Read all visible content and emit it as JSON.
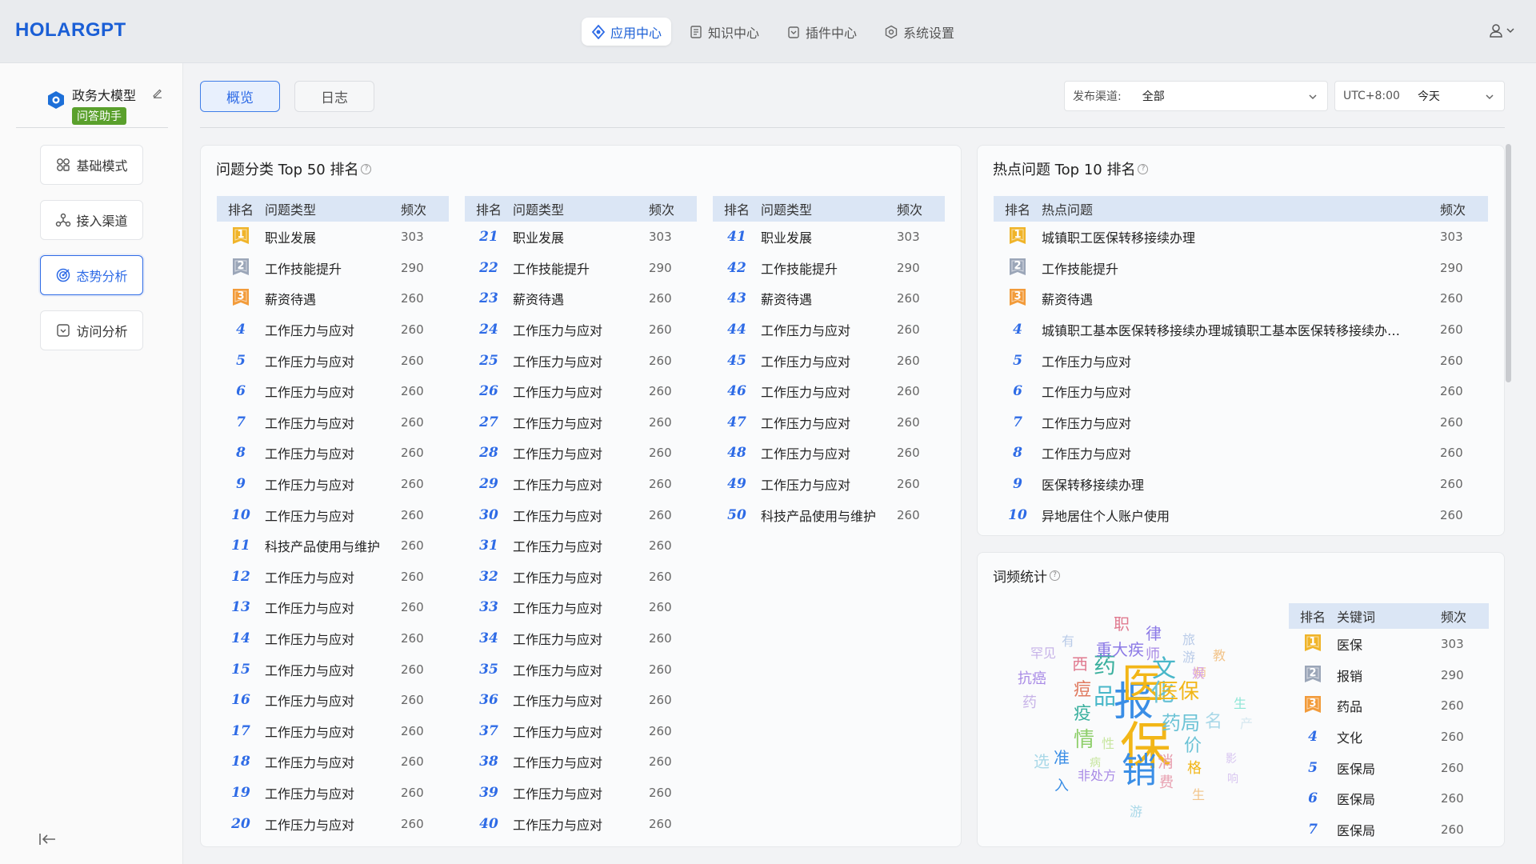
{
  "brand": {
    "logo": "HOLARGPT"
  },
  "nav": {
    "items": [
      {
        "label": "应用中心",
        "icon": "app-center-icon",
        "active": true
      },
      {
        "label": "知识中心",
        "icon": "knowledge-icon",
        "active": false
      },
      {
        "label": "插件中心",
        "icon": "plugin-icon",
        "active": false
      },
      {
        "label": "系统设置",
        "icon": "settings-icon",
        "active": false
      }
    ]
  },
  "sidebar": {
    "app_name": "政务大模型",
    "app_badge": "问答助手",
    "items": [
      {
        "label": "基础模式",
        "icon": "basic-mode-icon",
        "active": false
      },
      {
        "label": "接入渠道",
        "icon": "channel-icon",
        "active": false
      },
      {
        "label": "态势分析",
        "icon": "analysis-icon",
        "active": true
      },
      {
        "label": "访问分析",
        "icon": "visit-icon",
        "active": false
      }
    ]
  },
  "tabs": [
    {
      "label": "概览",
      "active": true
    },
    {
      "label": "日志",
      "active": false
    }
  ],
  "filters": {
    "channel_label": "发布渠道:",
    "channel_value": "全部",
    "tz_label": "UTC+8:00",
    "date_value": "今天"
  },
  "top50": {
    "title": "问题分类 Top 50 排名",
    "headers": {
      "rank": "排名",
      "type": "问题类型",
      "freq": "频次"
    },
    "col1": [
      {
        "rank": "1",
        "type": "职业发展",
        "freq": "303"
      },
      {
        "rank": "2",
        "type": "工作技能提升",
        "freq": "290"
      },
      {
        "rank": "3",
        "type": "薪资待遇",
        "freq": "260"
      },
      {
        "rank": "4",
        "type": "工作压力与应对",
        "freq": "260"
      },
      {
        "rank": "5",
        "type": "工作压力与应对",
        "freq": "260"
      },
      {
        "rank": "6",
        "type": "工作压力与应对",
        "freq": "260"
      },
      {
        "rank": "7",
        "type": "工作压力与应对",
        "freq": "260"
      },
      {
        "rank": "8",
        "type": "工作压力与应对",
        "freq": "260"
      },
      {
        "rank": "9",
        "type": "工作压力与应对",
        "freq": "260"
      },
      {
        "rank": "10",
        "type": "工作压力与应对",
        "freq": "260"
      },
      {
        "rank": "11",
        "type": "科技产品使用与维护",
        "freq": "260"
      },
      {
        "rank": "12",
        "type": "工作压力与应对",
        "freq": "260"
      },
      {
        "rank": "13",
        "type": "工作压力与应对",
        "freq": "260"
      },
      {
        "rank": "14",
        "type": "工作压力与应对",
        "freq": "260"
      },
      {
        "rank": "15",
        "type": "工作压力与应对",
        "freq": "260"
      },
      {
        "rank": "16",
        "type": "工作压力与应对",
        "freq": "260"
      },
      {
        "rank": "17",
        "type": "工作压力与应对",
        "freq": "260"
      },
      {
        "rank": "18",
        "type": "工作压力与应对",
        "freq": "260"
      },
      {
        "rank": "19",
        "type": "工作压力与应对",
        "freq": "260"
      },
      {
        "rank": "20",
        "type": "工作压力与应对",
        "freq": "260"
      }
    ],
    "col2": [
      {
        "rank": "21",
        "type": "职业发展",
        "freq": "303"
      },
      {
        "rank": "22",
        "type": "工作技能提升",
        "freq": "290"
      },
      {
        "rank": "23",
        "type": "薪资待遇",
        "freq": "260"
      },
      {
        "rank": "24",
        "type": "工作压力与应对",
        "freq": "260"
      },
      {
        "rank": "25",
        "type": "工作压力与应对",
        "freq": "260"
      },
      {
        "rank": "26",
        "type": "工作压力与应对",
        "freq": "260"
      },
      {
        "rank": "27",
        "type": "工作压力与应对",
        "freq": "260"
      },
      {
        "rank": "28",
        "type": "工作压力与应对",
        "freq": "260"
      },
      {
        "rank": "29",
        "type": "工作压力与应对",
        "freq": "260"
      },
      {
        "rank": "30",
        "type": "工作压力与应对",
        "freq": "260"
      },
      {
        "rank": "31",
        "type": "工作压力与应对",
        "freq": "260"
      },
      {
        "rank": "32",
        "type": "工作压力与应对",
        "freq": "260"
      },
      {
        "rank": "33",
        "type": "工作压力与应对",
        "freq": "260"
      },
      {
        "rank": "34",
        "type": "工作压力与应对",
        "freq": "260"
      },
      {
        "rank": "35",
        "type": "工作压力与应对",
        "freq": "260"
      },
      {
        "rank": "36",
        "type": "工作压力与应对",
        "freq": "260"
      },
      {
        "rank": "37",
        "type": "工作压力与应对",
        "freq": "260"
      },
      {
        "rank": "38",
        "type": "工作压力与应对",
        "freq": "260"
      },
      {
        "rank": "39",
        "type": "工作压力与应对",
        "freq": "260"
      },
      {
        "rank": "40",
        "type": "工作压力与应对",
        "freq": "260"
      }
    ],
    "col3": [
      {
        "rank": "41",
        "type": "职业发展",
        "freq": "303"
      },
      {
        "rank": "42",
        "type": "工作技能提升",
        "freq": "290"
      },
      {
        "rank": "43",
        "type": "薪资待遇",
        "freq": "260"
      },
      {
        "rank": "44",
        "type": "工作压力与应对",
        "freq": "260"
      },
      {
        "rank": "45",
        "type": "工作压力与应对",
        "freq": "260"
      },
      {
        "rank": "46",
        "type": "工作压力与应对",
        "freq": "260"
      },
      {
        "rank": "47",
        "type": "工作压力与应对",
        "freq": "260"
      },
      {
        "rank": "48",
        "type": "工作压力与应对",
        "freq": "260"
      },
      {
        "rank": "49",
        "type": "工作压力与应对",
        "freq": "260"
      },
      {
        "rank": "50",
        "type": "科技产品使用与维护",
        "freq": "260"
      }
    ]
  },
  "top10": {
    "title": "热点问题 Top 10 排名",
    "headers": {
      "rank": "排名",
      "type": "热点问题",
      "freq": "频次"
    },
    "rows": [
      {
        "rank": "1",
        "type": "城镇职工医保转移接续办理",
        "freq": "303"
      },
      {
        "rank": "2",
        "type": "工作技能提升",
        "freq": "290"
      },
      {
        "rank": "3",
        "type": "薪资待遇",
        "freq": "260"
      },
      {
        "rank": "4",
        "type": "城镇职工基本医保转移接续办理城镇职工基本医保转移接续办理城镇职工基本医保转移接续办理",
        "freq": "260"
      },
      {
        "rank": "5",
        "type": "工作压力与应对",
        "freq": "260"
      },
      {
        "rank": "6",
        "type": "工作压力与应对",
        "freq": "260"
      },
      {
        "rank": "7",
        "type": "工作压力与应对",
        "freq": "260"
      },
      {
        "rank": "8",
        "type": "工作压力与应对",
        "freq": "260"
      },
      {
        "rank": "9",
        "type": "医保转移接续办理",
        "freq": "260"
      },
      {
        "rank": "10",
        "type": "异地居住个人账户使用",
        "freq": "260"
      }
    ]
  },
  "wordfreq": {
    "title": "词频统计",
    "headers": {
      "rank": "排名",
      "type": "关键词",
      "freq": "频次"
    },
    "rows": [
      {
        "rank": "1",
        "type": "医保",
        "freq": "303"
      },
      {
        "rank": "2",
        "type": "报销",
        "freq": "290"
      },
      {
        "rank": "3",
        "type": "药品",
        "freq": "260"
      },
      {
        "rank": "4",
        "type": "文化",
        "freq": "260"
      },
      {
        "rank": "5",
        "type": "医保局",
        "freq": "260"
      },
      {
        "rank": "6",
        "type": "医保局",
        "freq": "260"
      },
      {
        "rank": "7",
        "type": "医保局",
        "freq": "260"
      }
    ],
    "cloud": [
      {
        "t": "保",
        "c": "#f2b617"
      },
      {
        "t": "报",
        "c": "#3a8ee6"
      },
      {
        "t": "医",
        "c": "#f2b617"
      },
      {
        "t": "销",
        "c": "#3a8ee6"
      },
      {
        "t": "文",
        "c": "#49b7c9"
      },
      {
        "t": "化",
        "c": "#6cc3d6"
      },
      {
        "t": "药",
        "c": "#3ab09e"
      },
      {
        "t": "品",
        "c": "#49b7c9"
      },
      {
        "t": "医保",
        "c": "#f2b617"
      },
      {
        "t": "药局",
        "c": "#6cc3d6"
      },
      {
        "t": "名",
        "c": "#a9d8e8"
      },
      {
        "t": "情",
        "c": "#8ecf6b"
      },
      {
        "t": "疫",
        "c": "#3ab09e"
      },
      {
        "t": "痘",
        "c": "#e07a5f"
      },
      {
        "t": "重大疾",
        "c": "#8c7ae6"
      },
      {
        "t": "职",
        "c": "#e07a8f"
      },
      {
        "t": "律",
        "c": "#8c7ae6"
      },
      {
        "t": "师",
        "c": "#a98be6"
      },
      {
        "t": "抗癌",
        "c": "#a98be6"
      },
      {
        "t": "西",
        "c": "#e07a8f"
      },
      {
        "t": "价",
        "c": "#6cc3d6"
      },
      {
        "t": "格",
        "c": "#f2b617"
      },
      {
        "t": "消",
        "c": "#e8a0b0"
      },
      {
        "t": "费",
        "c": "#e8a0b0"
      },
      {
        "t": "准",
        "c": "#3a8ee6"
      },
      {
        "t": "选",
        "c": "#a9d8e8"
      },
      {
        "t": "入",
        "c": "#3a8ee6"
      },
      {
        "t": "非处方",
        "c": "#a98be6"
      },
      {
        "t": "旅",
        "c": "#b9cbe8"
      },
      {
        "t": "游",
        "c": "#b9cbe8"
      },
      {
        "t": "教",
        "c": "#f2c48a"
      },
      {
        "t": "师",
        "c": "#f2c48a"
      },
      {
        "t": "娱",
        "c": "#d8a6e8"
      },
      {
        "t": "罕见",
        "c": "#c7b3e8"
      },
      {
        "t": "有",
        "c": "#b9cbe8"
      },
      {
        "t": "性",
        "c": "#c8e6a0"
      },
      {
        "t": "病",
        "c": "#c8e6a0"
      },
      {
        "t": "生",
        "c": "#f2c48a"
      },
      {
        "t": "影",
        "c": "#d8c6f0"
      },
      {
        "t": "响",
        "c": "#d8c6f0"
      },
      {
        "t": "药",
        "c": "#c7b3e8"
      },
      {
        "t": "游",
        "c": "#a9d8e8"
      },
      {
        "t": "生",
        "c": "#8ee6d6"
      },
      {
        "t": "产",
        "c": "#d6e8f0"
      }
    ]
  }
}
